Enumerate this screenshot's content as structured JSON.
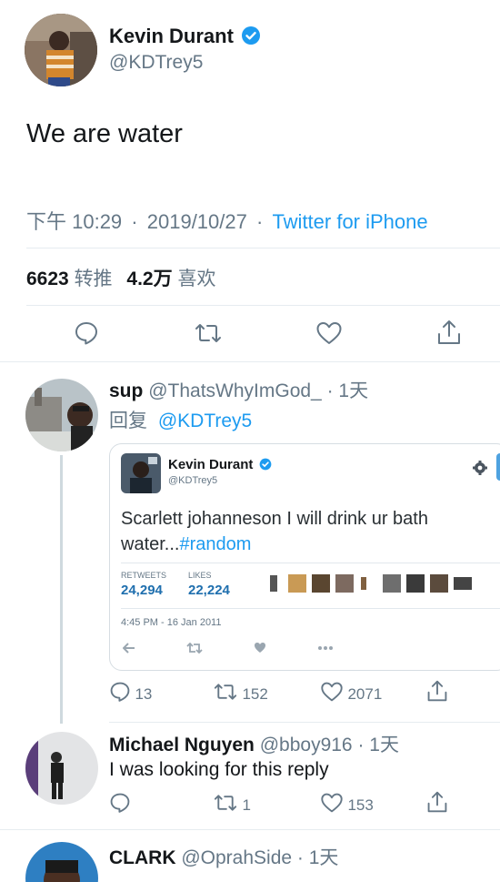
{
  "main_tweet": {
    "author_name": "Kevin Durant",
    "author_handle": "@KDTrey5",
    "text": "We are water",
    "time": "下午 10:29",
    "sep1": "·",
    "date": "2019/10/27",
    "sep2": "·",
    "source": "Twitter for iPhone",
    "retweets_count": "6623",
    "retweets_label": "转推",
    "likes_count": "4.2万",
    "likes_label": "喜欢"
  },
  "reply1": {
    "author_name": "sup",
    "author_handle": "@ThatsWhyImGod_",
    "time": "· 1天",
    "reply_prefix": "回复",
    "reply_to": "@KDTrey5",
    "embedded": {
      "author_name": "Kevin Durant",
      "author_handle": "@KDTrey5",
      "text_main": "Scarlett johanneson I will drink ur bath water...",
      "hashtag": "#random",
      "retweets_label": "RETWEETS",
      "retweets_value": "24,294",
      "likes_label": "LIKES",
      "likes_value": "22,224",
      "timestamp": "4:45 PM - 16 Jan 2011"
    },
    "comments": "13",
    "retweets": "152",
    "likes": "2071"
  },
  "reply2": {
    "author_name": "Michael Nguyen",
    "author_handle": "@bboy916",
    "time": "· 1天",
    "text": "I was looking for this reply",
    "comments": "",
    "retweets": "1",
    "likes": "153"
  },
  "reply3": {
    "author_name": "CLARK",
    "author_handle": "@OprahSide",
    "time": "· 1天"
  },
  "colors": {
    "accent": "#1d9bf0",
    "text": "#14171a",
    "muted": "#657786",
    "divider": "#e6ecf0"
  }
}
